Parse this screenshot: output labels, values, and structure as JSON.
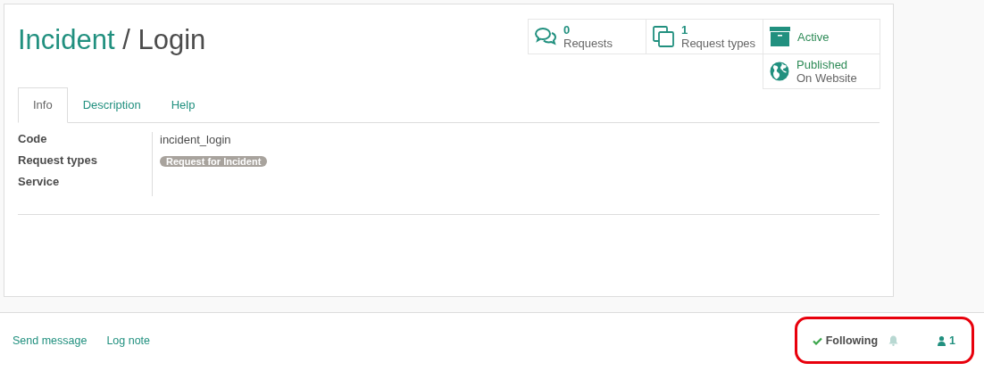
{
  "breadcrumb": {
    "parent": "Incident",
    "separator": "/",
    "current": "Login"
  },
  "stat_buttons": [
    {
      "kind": "comments",
      "value": "0",
      "label": "Requests"
    },
    {
      "kind": "copies",
      "value": "1",
      "label": "Request types"
    },
    {
      "kind": "archive",
      "value": "Active"
    },
    {
      "kind": "globe",
      "value": "Published",
      "label": "On Website"
    }
  ],
  "tabs": [
    {
      "label": "Info",
      "selected": true
    },
    {
      "label": "Description",
      "selected": false
    },
    {
      "label": "Help",
      "selected": false
    }
  ],
  "fields": [
    {
      "label": "Code",
      "kind": "text",
      "value": "incident_login"
    },
    {
      "label": "Request types",
      "kind": "tags",
      "tags": [
        "Request for Incident"
      ]
    },
    {
      "label": "Service",
      "kind": "text"
    }
  ],
  "chatter": {
    "actions": [
      "Send message",
      "Log note"
    ],
    "following": true,
    "follow_label": "Following",
    "followers_count": "1",
    "highlighted": true
  }
}
